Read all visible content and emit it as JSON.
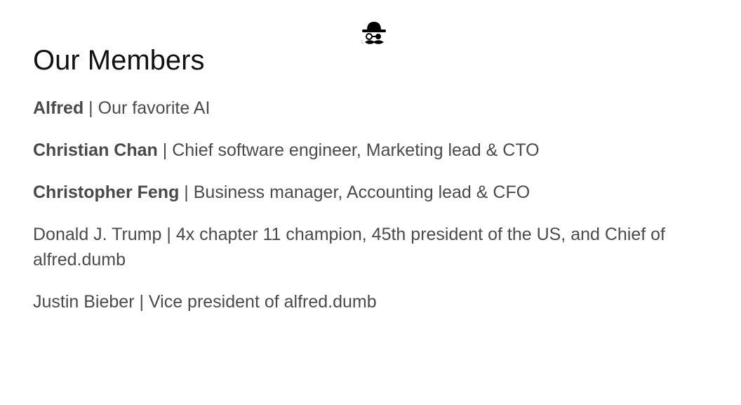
{
  "header": {
    "logo_icon": "incognito-mustache-icon",
    "title": "Our Members"
  },
  "members": [
    {
      "name": "Alfred",
      "separator": " | ",
      "role": "Our favorite AI"
    },
    {
      "name": "Christian Chan",
      "separator": " | ",
      "role": "Chief software engineer, Marketing lead & CTO"
    },
    {
      "name": "Christopher Feng",
      "separator": " | ",
      "role": "Business manager, Accounting lead & CFO"
    },
    {
      "name": "Donald J. Trump",
      "separator": " | ",
      "role": "4x chapter 11 champion, 45th president of the US, and Chief of alfred.dumb"
    },
    {
      "name": "Justin Bieber",
      "separator": " | ",
      "role": "Vice president of alfred.dumb"
    }
  ]
}
